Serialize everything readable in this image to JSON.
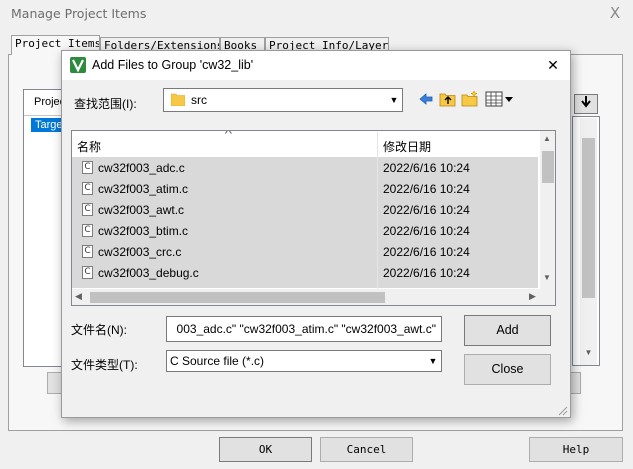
{
  "outer": {
    "title": "Manage Project Items",
    "close_glyph": "X",
    "tabs": [
      "Project Items",
      "Folders/Extensions",
      "Books",
      "Project Info/Layer"
    ],
    "list_header": "Project",
    "list_item": "Target",
    "ok_label": "OK",
    "cancel_label": "Cancel",
    "help_label": "Help"
  },
  "dialog": {
    "title": "Add Files to Group 'cw32_lib'",
    "close_glyph": "✕",
    "look_in_label": "查找范围(I):",
    "look_in_value": "src",
    "columns": {
      "name": "名称",
      "date": "修改日期"
    },
    "files": [
      {
        "name": "cw32f003_adc.c",
        "date": "2022/6/16 10:24",
        "icon": "c-file-icon"
      },
      {
        "name": "cw32f003_atim.c",
        "date": "2022/6/16 10:24",
        "icon": "c-file-icon"
      },
      {
        "name": "cw32f003_awt.c",
        "date": "2022/6/16 10:24",
        "icon": "c-file-icon"
      },
      {
        "name": "cw32f003_btim.c",
        "date": "2022/6/16 10:24",
        "icon": "c-file-icon"
      },
      {
        "name": "cw32f003_crc.c",
        "date": "2022/6/16 10:24",
        "icon": "c-file-icon"
      },
      {
        "name": "cw32f003_debug.c",
        "date": "2022/6/16 10:24",
        "icon": "c-file-icon"
      }
    ],
    "file_name_label": "文件名(N):",
    "file_name_value": "003_adc.c\" \"cw32f003_atim.c\" \"cw32f003_awt.c\"",
    "file_type_label": "文件类型(T):",
    "file_type_value": "C Source file (*.c)",
    "add_label": "Add",
    "close_label": "Close"
  },
  "colors": {
    "selection": "#d9d9d9",
    "accent": "#0078d7",
    "folder": "#f7c846"
  }
}
